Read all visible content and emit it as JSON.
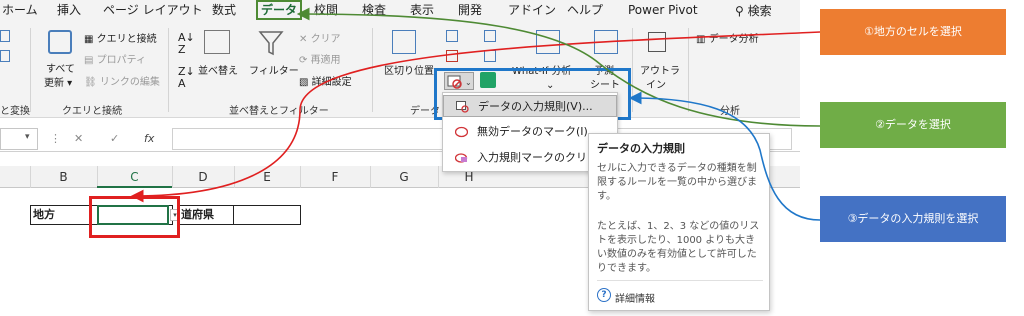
{
  "tabs": [
    "ホーム",
    "挿入",
    "ページ レイアウト",
    "数式",
    "データ",
    "校閲",
    "検査",
    "表示",
    "開発",
    "アドイン",
    "ヘルプ",
    "Power Pivot"
  ],
  "active_tab": "データ",
  "search_label": "検索",
  "ribbon": {
    "left_edge_label": "と変換",
    "refresh_label_1": "すべて",
    "refresh_label_2": "更新",
    "query_conn": "クエリと接続",
    "properties": "プロパティ",
    "edit_links": "リンクの編集",
    "group_query": "クエリと接続",
    "sort": "並べ替え",
    "filter": "フィルター",
    "clear": "クリア",
    "reapply": "再適用",
    "advanced": "詳細設定",
    "group_sort": "並べ替えとフィルター",
    "text_to_columns": "区切り位置",
    "group_data_tools": "データ",
    "what_if": "What-If 分析",
    "forecast_1": "予測",
    "forecast_2": "シート",
    "outline_1": "アウトラ",
    "outline_2": "イン",
    "data_analysis": "データ分析",
    "group_analysis": "分析"
  },
  "formula_bar": {
    "fx": "fx"
  },
  "columns": [
    "B",
    "C",
    "D",
    "E",
    "F",
    "G",
    "H"
  ],
  "cells": {
    "label_region": "地方",
    "label_prefecture": "道府県"
  },
  "menu": {
    "items": [
      {
        "label": "データの入力規則(V)..."
      },
      {
        "label": "無効データのマーク(I)"
      },
      {
        "label": "入力規則マークのクリア(R)"
      }
    ]
  },
  "tooltip": {
    "title": "データの入力規則",
    "para1": "セルに入力できるデータの種類を制限するルールを一覧の中から選びます。",
    "para2": "たとえば、1、2、3 などの値のリストを表示したり、1000 よりも大きい数値のみを有効値として許可したりできます。",
    "more": "詳細情報"
  },
  "callouts": {
    "step1": "①地方のセルを選択",
    "step2": "②データを選択",
    "step3": "③データの入力規則を選択"
  },
  "colors": {
    "orange": "#ed7d31",
    "green": "#70ad47",
    "blue": "#4472c4",
    "red": "#e02020",
    "excel_green": "#217346"
  }
}
